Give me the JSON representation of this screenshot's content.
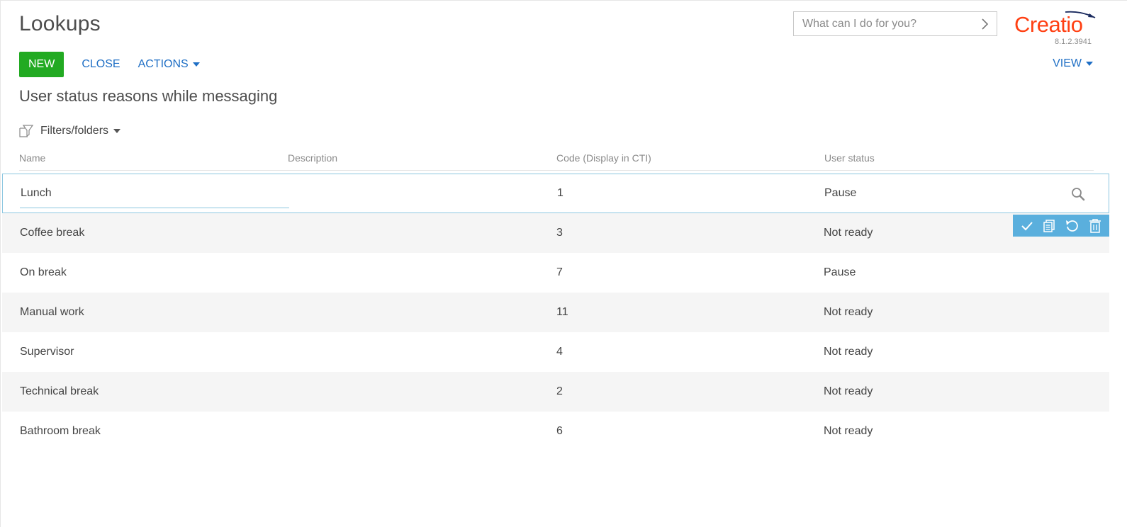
{
  "header": {
    "title": "Lookups",
    "search_placeholder": "What can I do for you?",
    "logo_text": "Creatio",
    "version": "8.1.2.3941"
  },
  "toolbar": {
    "new_label": "NEW",
    "close_label": "CLOSE",
    "actions_label": "ACTIONS",
    "view_label": "VIEW"
  },
  "section": {
    "title": "User status reasons while messaging",
    "filters_label": "Filters/folders"
  },
  "grid": {
    "columns": [
      "Name",
      "Description",
      "Code (Display in CTI)",
      "User status"
    ],
    "rows": [
      {
        "name": "Lunch",
        "description": "",
        "code": "1",
        "status": "Pause"
      },
      {
        "name": "Coffee break",
        "description": "",
        "code": "3",
        "status": "Not ready"
      },
      {
        "name": "On break",
        "description": "",
        "code": "7",
        "status": "Pause"
      },
      {
        "name": "Manual work",
        "description": "",
        "code": "11",
        "status": "Not ready"
      },
      {
        "name": "Supervisor",
        "description": "",
        "code": "4",
        "status": "Not ready"
      },
      {
        "name": "Technical break",
        "description": "",
        "code": "2",
        "status": "Not ready"
      },
      {
        "name": "Bathroom break",
        "description": "",
        "code": "6",
        "status": "Not ready"
      }
    ]
  },
  "row_actions": [
    "check-icon",
    "copy-icon",
    "undo-icon",
    "trash-icon"
  ],
  "colors": {
    "accent_blue": "#1f6fc5",
    "new_button": "#22aa22",
    "logo": "#ff4013",
    "row_action_bar": "#5aafdd"
  }
}
